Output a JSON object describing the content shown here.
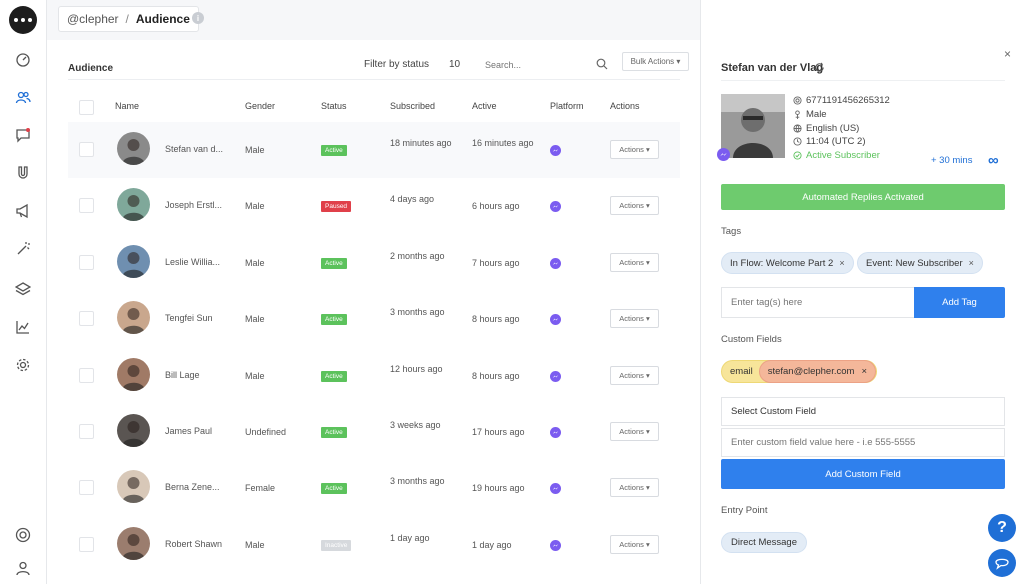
{
  "breadcrumb": {
    "handle": "@clepher",
    "separator": "/",
    "page": "Audience"
  },
  "list": {
    "title": "Audience",
    "filter_label": "Filter by status",
    "filter_count": "10",
    "search_placeholder": "Search...",
    "bulk_actions": "Bulk Actions ▾",
    "columns": [
      "Name",
      "Gender",
      "Status",
      "Subscribed",
      "Active",
      "Platform",
      "Actions"
    ],
    "rows": [
      {
        "name": "Stefan van d...",
        "gender": "Male",
        "status": "Active",
        "subscribed": "18 minutes ago",
        "active": "16 minutes ago",
        "action": "Actions ▾"
      },
      {
        "name": "Joseph Erstl...",
        "gender": "Male",
        "status": "Paused",
        "subscribed": "4 days ago",
        "active": "6 hours ago",
        "action": "Actions ▾"
      },
      {
        "name": "Leslie Willia...",
        "gender": "Male",
        "status": "Active",
        "subscribed": "2 months ago",
        "active": "7 hours ago",
        "action": "Actions ▾"
      },
      {
        "name": "Tengfei Sun",
        "gender": "Male",
        "status": "Active",
        "subscribed": "3 months ago",
        "active": "8 hours ago",
        "action": "Actions ▾"
      },
      {
        "name": "Bill Lage",
        "gender": "Male",
        "status": "Active",
        "subscribed": "12 hours ago",
        "active": "8 hours ago",
        "action": "Actions ▾"
      },
      {
        "name": "James Paul",
        "gender": "Undefined",
        "status": "Active",
        "subscribed": "3 weeks ago",
        "active": "17 hours ago",
        "action": "Actions ▾"
      },
      {
        "name": "Berna Zene...",
        "gender": "Female",
        "status": "Active",
        "subscribed": "3 months ago",
        "active": "19 hours ago",
        "action": "Actions ▾"
      },
      {
        "name": "Robert Shawn",
        "gender": "Male",
        "status": "Inactive",
        "subscribed": "1 day ago",
        "active": "1 day ago",
        "action": "Actions ▾"
      }
    ]
  },
  "colors": {
    "active": "#5cc25c",
    "paused": "#e0404a",
    "inactive": "#d6d9dd",
    "accent": "#2f80ed",
    "green_button": "#6ecb6e"
  },
  "panel": {
    "name": "Stefan van der Vlag",
    "close": "×",
    "id": "6771191456265312",
    "gender": "Male",
    "language": "English (US)",
    "time": "11:04 (UTC 2)",
    "subscriber_status": "Active Subscriber",
    "time_offset": "+ 30 mins",
    "infinity": "∞",
    "automated_replies": "Automated Replies Activated",
    "tags_label": "Tags",
    "tags": [
      "In Flow: Welcome Part 2",
      "Event: New Subscriber"
    ],
    "tag_remove": "×",
    "tag_input_placeholder": "Enter tag(s) here",
    "add_tag": "Add Tag",
    "custom_fields_label": "Custom Fields",
    "custom_field": {
      "key": "email",
      "value": "stefan@clepher.com",
      "remove": "×"
    },
    "select_custom_field": "Select Custom Field",
    "custom_value_placeholder": "Enter custom field value here - i.e 555-5555",
    "add_custom_field": "Add Custom Field",
    "entry_point_label": "Entry Point",
    "entry_point": "Direct Message",
    "help": "?"
  },
  "icons": {
    "sidebar": [
      "dashboard-icon",
      "users-icon",
      "chat-icon",
      "magnet-icon",
      "megaphone-icon",
      "magic-wand-icon",
      "layers-icon",
      "analytics-icon",
      "settings-icon",
      "lifebuoy-icon",
      "profile-icon"
    ]
  }
}
